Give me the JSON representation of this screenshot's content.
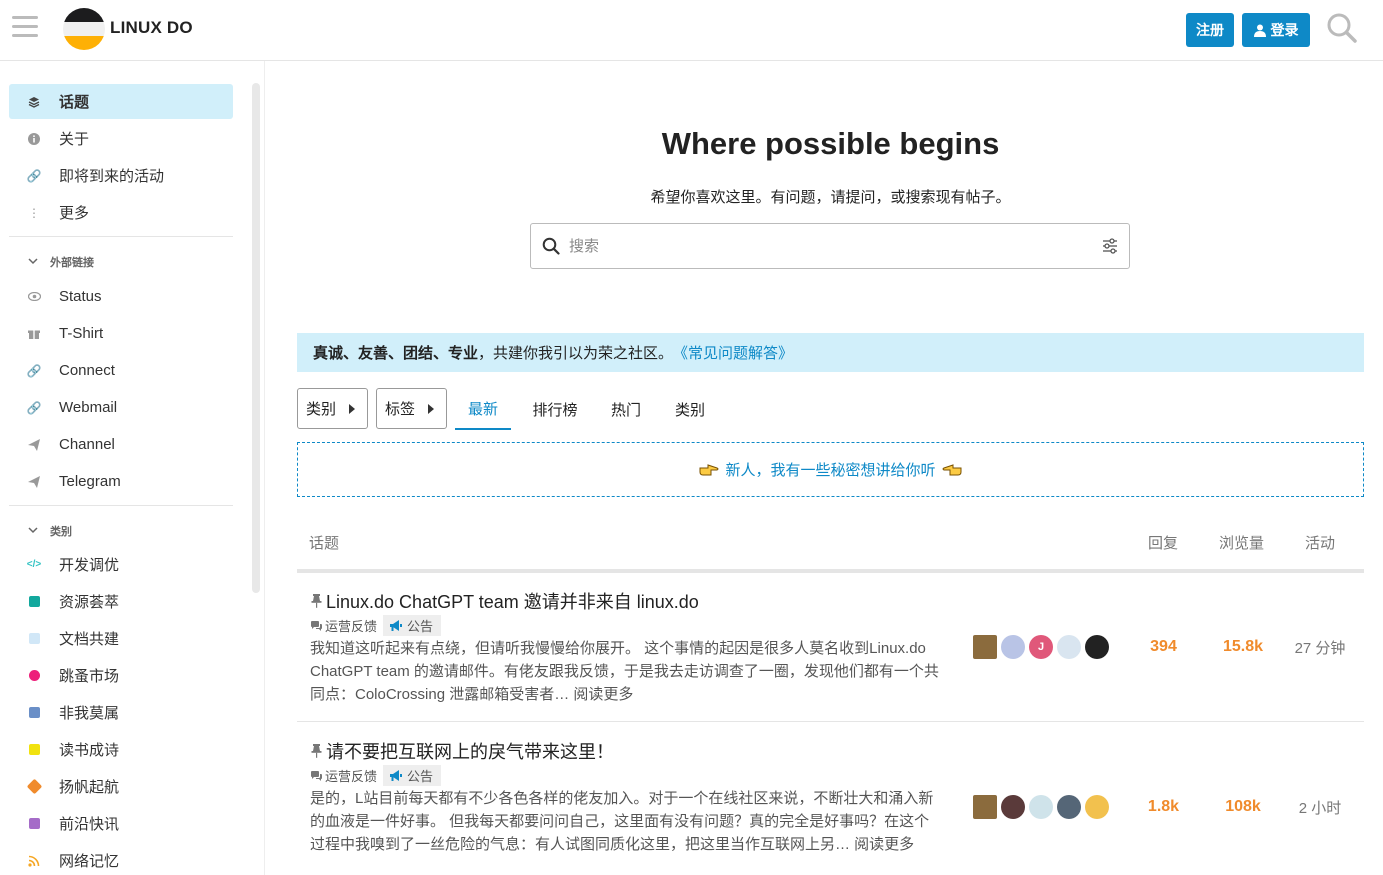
{
  "header": {
    "site_name": "LINUX DO",
    "signup_label": "注册",
    "login_label": "登录"
  },
  "sidebar": {
    "nav": [
      {
        "label": "话题",
        "icon": "layers-icon"
      },
      {
        "label": "关于",
        "icon": "info-icon"
      },
      {
        "label": "即将到来的活动",
        "icon": "link-icon"
      },
      {
        "label": "更多",
        "icon": "more-vertical-icon"
      }
    ],
    "external_heading": "外部链接",
    "external": [
      {
        "label": "Status",
        "icon": "eye-icon"
      },
      {
        "label": "T-Shirt",
        "icon": "gift-icon"
      },
      {
        "label": "Connect",
        "icon": "link-icon"
      },
      {
        "label": "Webmail",
        "icon": "link-icon"
      },
      {
        "label": "Channel",
        "icon": "send-icon"
      },
      {
        "label": "Telegram",
        "icon": "send-icon"
      }
    ],
    "categories_heading": "类别",
    "categories": [
      {
        "label": "开发调优",
        "color": "#32c3c3"
      },
      {
        "label": "资源荟萃",
        "color": "#12a89d"
      },
      {
        "label": "文档共建",
        "color": "#d1e7f7"
      },
      {
        "label": "跳蚤市场",
        "color": "#ed207b"
      },
      {
        "label": "非我莫属",
        "color": "#6a8fc7"
      },
      {
        "label": "读书成诗",
        "color": "#f1e20f"
      },
      {
        "label": "扬帆起航",
        "color": "#f08b2c"
      },
      {
        "label": "前沿快讯",
        "color": "#a56cc8"
      },
      {
        "label": "网络记忆",
        "color": "#f5a623"
      }
    ]
  },
  "hero": {
    "title": "Where possible begins",
    "subtitle": "希望你喜欢这里。有问题，请提问，或搜索现有帖子。",
    "search_placeholder": "搜索"
  },
  "banner": {
    "bold_text": "真诚、友善、团结、专业",
    "text": "，共建你我引以为荣之社区。",
    "link": "《常见问题解答》"
  },
  "nav": {
    "category_dropdown": "类别",
    "tag_dropdown": "标签",
    "tabs": [
      "最新",
      "排行榜",
      "热门",
      "类别"
    ],
    "active_tab": "最新"
  },
  "promo": {
    "text": "新人，我有一些秘密想讲给你听"
  },
  "table": {
    "headers": {
      "topic": "话题",
      "replies": "回复",
      "views": "浏览量",
      "activity": "活动"
    }
  },
  "topics": [
    {
      "title": "Linux.do ChatGPT team 邀请并非来自 linux.do",
      "category": "运营反馈",
      "tag": "公告",
      "excerpt": "我知道这听起来有点绕，但请听我慢慢给你展开。 这个事情的起因是很多人莫名收到Linux.do ChatGPT team 的邀请邮件。有佬友跟我反馈，于是我去走访调查了一圈，发现他们都有一个共同点：ColoCrossing 泄露邮箱受害者… 阅读更多",
      "posters": [
        {
          "initial": "",
          "color": "#8b6b3d"
        },
        {
          "initial": "",
          "color": "#b9c4e6"
        },
        {
          "initial": "J",
          "color": "#e0587a"
        },
        {
          "initial": "",
          "color": "#d9e5f0"
        },
        {
          "initial": "",
          "color": "#222222"
        }
      ],
      "replies": "394",
      "views": "15.8k",
      "activity": "27 分钟"
    },
    {
      "title": "请不要把互联网上的戾气带来这里！",
      "category": "运营反馈",
      "tag": "公告",
      "excerpt": "是的，L站目前每天都有不少各色各样的佬友加入。对于一个在线社区来说，不断壮大和涌入新的血液是一件好事。 但我每天都要问问自己，这里面有没有问题？真的完全是好事吗？在这个过程中我嗅到了一丝危险的气息：有人试图同质化这里，把这里当作互联网上另… 阅读更多",
      "posters": [
        {
          "initial": "",
          "color": "#8b6b3d"
        },
        {
          "initial": "",
          "color": "#5a3a3a"
        },
        {
          "initial": "",
          "color": "#cfe3ea"
        },
        {
          "initial": "",
          "color": "#556677"
        },
        {
          "initial": "",
          "color": "#f2c14e"
        }
      ],
      "replies": "1.8k",
      "views": "108k",
      "activity": "2 小时"
    }
  ]
}
